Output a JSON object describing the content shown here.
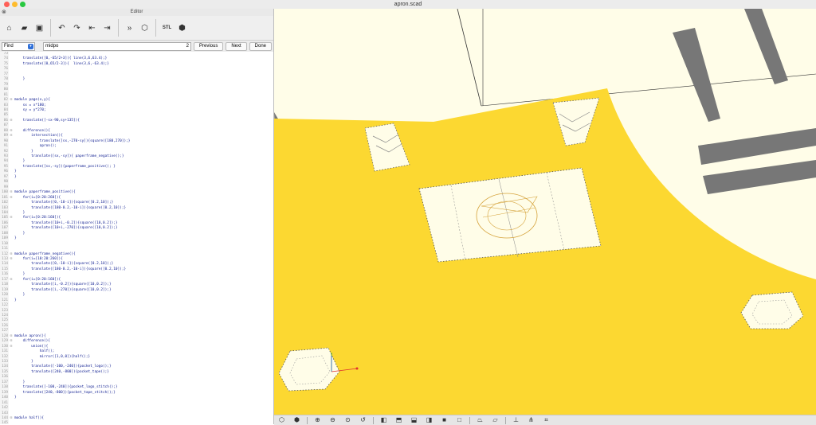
{
  "window": {
    "title": "apron.scad"
  },
  "editor": {
    "title": "Editor",
    "toolbar_icons": [
      "new-file-icon",
      "open-file-icon",
      "save-icon",
      "undo-icon",
      "redo-icon",
      "unindent-icon",
      "indent-icon",
      "preview-icon",
      "render-icon",
      "stl-export-icon",
      "send-to-print-icon"
    ],
    "stl_label": "STL",
    "find": {
      "mode": "Find",
      "query": "midpo",
      "count": "2",
      "previous": "Previous",
      "next": "Next",
      "done": "Done"
    },
    "lines": [
      {
        "n": "73",
        "f": "",
        "t": ""
      },
      {
        "n": "74",
        "f": "",
        "t": "    translate([0,-65/2+3]){ line(3,6,63.4);}"
      },
      {
        "n": "75",
        "f": "",
        "t": "    translate([0,65/2-3]){  line(3,6,-63.4);}"
      },
      {
        "n": "76",
        "f": "",
        "t": ""
      },
      {
        "n": "77",
        "f": "",
        "t": ""
      },
      {
        "n": "78",
        "f": "",
        "t": "    }"
      },
      {
        "n": "79",
        "f": "",
        "t": ""
      },
      {
        "n": "80",
        "f": "",
        "t": ""
      },
      {
        "n": "81",
        "f": "",
        "t": ""
      },
      {
        "n": "82",
        "f": "⊟",
        "t": "module page(x,y){"
      },
      {
        "n": "83",
        "f": "",
        "t": "    sx = x*180;"
      },
      {
        "n": "84",
        "f": "",
        "t": "    sy = y*270;"
      },
      {
        "n": "85",
        "f": "",
        "t": ""
      },
      {
        "n": "86",
        "f": "⊟",
        "t": "    translate([-sx-90,sy+135]){"
      },
      {
        "n": "87",
        "f": "",
        "t": ""
      },
      {
        "n": "88",
        "f": "⊟",
        "t": "    difference(){"
      },
      {
        "n": "89",
        "f": "⊟",
        "t": "        intersection(){"
      },
      {
        "n": "90",
        "f": "",
        "t": "            translate([sx,-270-sy]){square([180,270]);}"
      },
      {
        "n": "91",
        "f": "",
        "t": "            apron();"
      },
      {
        "n": "92",
        "f": "",
        "t": "        }"
      },
      {
        "n": "93",
        "f": "",
        "t": "        translate([sx,-sy]){ paperframe_negative();}"
      },
      {
        "n": "94",
        "f": "",
        "t": "    }"
      },
      {
        "n": "95",
        "f": "",
        "t": "    translate([sx,-sy]){paperframe_positive(); }"
      },
      {
        "n": "96",
        "f": "",
        "t": "}"
      },
      {
        "n": "97",
        "f": "",
        "t": "}"
      },
      {
        "n": "98",
        "f": "",
        "t": ""
      },
      {
        "n": "99",
        "f": "",
        "t": ""
      },
      {
        "n": "100",
        "f": "⊟",
        "t": "module paperframe_positive(){"
      },
      {
        "n": "101",
        "f": "⊟",
        "t": "    for(i=[0:20:260]){"
      },
      {
        "n": "102",
        "f": "",
        "t": "        translate([0,-10-i]){square([0.2,10]);}"
      },
      {
        "n": "103",
        "f": "",
        "t": "        translate([180-0.2,-10-i]){square([0.2,10]);}"
      },
      {
        "n": "104",
        "f": "",
        "t": "    }"
      },
      {
        "n": "105",
        "f": "⊟",
        "t": "    for(i=[0:20:160]){"
      },
      {
        "n": "106",
        "f": "",
        "t": "        translate([10+i,-0.2]){square([10,0.2]);}"
      },
      {
        "n": "107",
        "f": "",
        "t": "        translate([10+i,-270]){square([10,0.2]);}"
      },
      {
        "n": "108",
        "f": "",
        "t": "    }"
      },
      {
        "n": "109",
        "f": "",
        "t": "}"
      },
      {
        "n": "110",
        "f": "",
        "t": ""
      },
      {
        "n": "111",
        "f": "",
        "t": ""
      },
      {
        "n": "112",
        "f": "⊟",
        "t": "module paperframe_negative(){"
      },
      {
        "n": "113",
        "f": "⊟",
        "t": "    for(i=[10:20:260]){"
      },
      {
        "n": "114",
        "f": "",
        "t": "        translate([0,-10-i]){square([0.2,10]);}"
      },
      {
        "n": "115",
        "f": "",
        "t": "        translate([180-0.2,-10-i]){square([0.2,10]);}"
      },
      {
        "n": "116",
        "f": "",
        "t": "    }"
      },
      {
        "n": "117",
        "f": "⊟",
        "t": "    for(i=[0:20:160]){"
      },
      {
        "n": "118",
        "f": "",
        "t": "        translate([i,-0.2]){square([10,0.2]);}"
      },
      {
        "n": "119",
        "f": "",
        "t": "        translate([i,-270]){square([10,0.2]);}"
      },
      {
        "n": "120",
        "f": "",
        "t": "    }"
      },
      {
        "n": "121",
        "f": "",
        "t": "}"
      },
      {
        "n": "122",
        "f": "",
        "t": ""
      },
      {
        "n": "123",
        "f": "",
        "t": ""
      },
      {
        "n": "124",
        "f": "",
        "t": ""
      },
      {
        "n": "125",
        "f": "",
        "t": ""
      },
      {
        "n": "126",
        "f": "",
        "t": ""
      },
      {
        "n": "127",
        "f": "",
        "t": ""
      },
      {
        "n": "128",
        "f": "⊟",
        "t": "module apron(){"
      },
      {
        "n": "129",
        "f": "⊟",
        "t": "    difference(){"
      },
      {
        "n": "130",
        "f": "⊟",
        "t": "        union(){"
      },
      {
        "n": "131",
        "f": "",
        "t": "            half();"
      },
      {
        "n": "132",
        "f": "",
        "t": "            mirror([1,0,0]){half();}"
      },
      {
        "n": "133",
        "f": "",
        "t": "        }"
      },
      {
        "n": "134",
        "f": "",
        "t": "        translate([-100,-240]){pocket_logo();}"
      },
      {
        "n": "135",
        "f": "",
        "t": "        translate([240,-800]){pocket_tape();}"
      },
      {
        "n": "136",
        "f": "",
        "t": ""
      },
      {
        "n": "137",
        "f": "",
        "t": "    }"
      },
      {
        "n": "138",
        "f": "",
        "t": "    translate([-100,-240]){pocket_logo_stitch();}"
      },
      {
        "n": "139",
        "f": "",
        "t": "    translate([240,-800]){pocket_tape_stitch();}"
      },
      {
        "n": "140",
        "f": "",
        "t": "}"
      },
      {
        "n": "141",
        "f": "",
        "t": ""
      },
      {
        "n": "142",
        "f": "",
        "t": ""
      },
      {
        "n": "143",
        "f": "",
        "t": ""
      },
      {
        "n": "144",
        "f": "⊟",
        "t": "module half(){"
      },
      {
        "n": "145",
        "f": "",
        "t": ""
      },
      {
        "n": "146",
        "f": "",
        "t": "    difference(){"
      }
    ]
  },
  "viewport": {
    "background": "#fffde8",
    "apron_color": "#fcd831",
    "toolbar_icons": [
      "view-all-icon",
      "reset-view-icon",
      "zoom-in-icon",
      "zoom-out-icon",
      "zoom-fit-icon",
      "rotate-reset-icon",
      "view-right-icon",
      "view-top-icon",
      "view-bottom-icon",
      "view-left-icon",
      "view-front-icon",
      "view-back-icon",
      "perspective-icon",
      "orthogonal-icon",
      "axes-icon",
      "scale-markers-icon",
      "edges-icon"
    ]
  }
}
